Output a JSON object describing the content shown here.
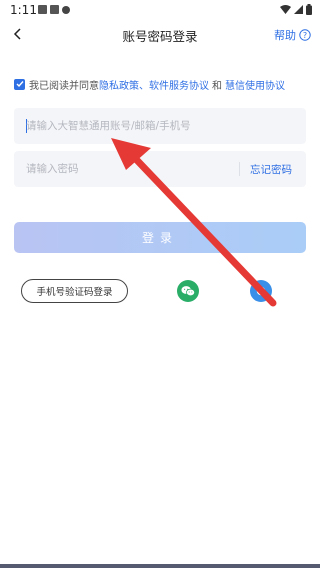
{
  "status_bar": {
    "time": "1:11",
    "icons": [
      "image-icon",
      "a-icon",
      "circle-icon"
    ],
    "right_icons": [
      "wifi-icon",
      "signal-icon",
      "battery-icon"
    ]
  },
  "nav": {
    "title": "账号密码登录",
    "help_label": "帮助"
  },
  "agreement": {
    "checked": true,
    "prefix": "我已阅读并同意",
    "link_privacy": "隐私政策、软件服务协议",
    "joiner": "和",
    "link_usage": "慧信使用协议"
  },
  "form": {
    "account_placeholder": "请输入大智慧通用账号/邮箱/手机号",
    "account_value": "",
    "password_placeholder": "请输入密码",
    "password_value": "",
    "forgot_label": "忘记密码"
  },
  "login_button_label": "登录",
  "alt_login": {
    "phone_label": "手机号验证码登录",
    "icons": [
      "wechat-icon",
      "third-party-login-icon"
    ]
  },
  "colors": {
    "accent": "#2f6fe4",
    "wechat": "#2aae67",
    "annotation_arrow": "#e53935"
  }
}
